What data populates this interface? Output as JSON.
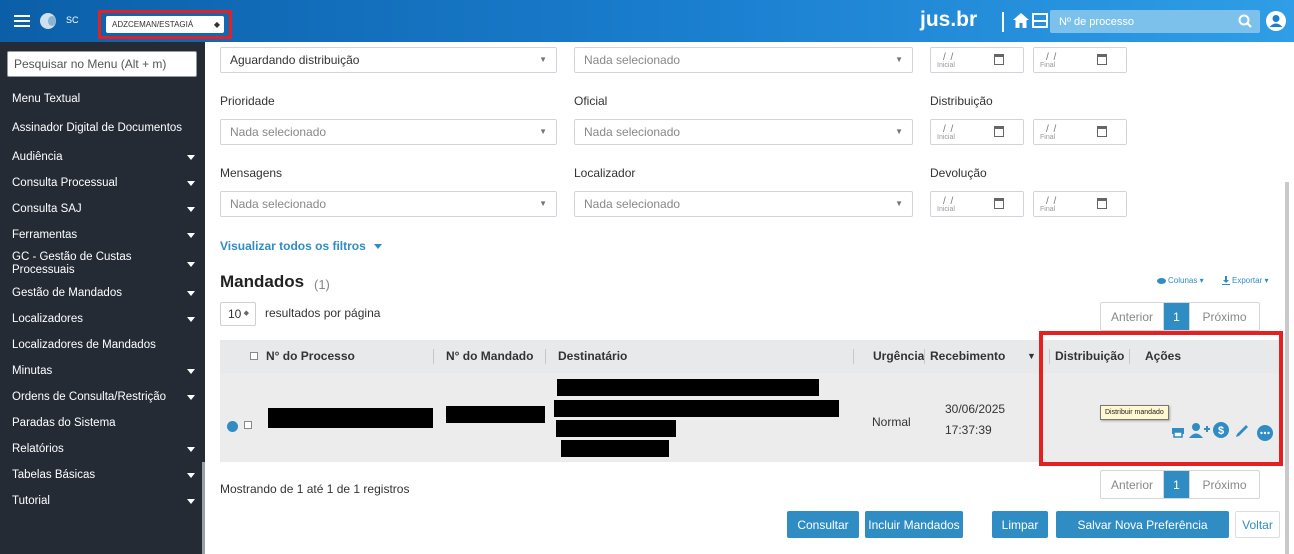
{
  "topbar": {
    "uf": "SC",
    "profile": "ADZCEMAN/ESTAGIÁ",
    "brand": "jus.br",
    "process_placeholder": "Nº de processo"
  },
  "sidebar": {
    "search_placeholder": "Pesquisar no Menu (Alt + m)",
    "items": [
      {
        "label": "Menu Textual",
        "submenu": false
      },
      {
        "label": "Assinador Digital de Documentos",
        "submenu": false
      },
      {
        "label": "Audiência",
        "submenu": true
      },
      {
        "label": "Consulta Processual",
        "submenu": true
      },
      {
        "label": "Consulta SAJ",
        "submenu": true
      },
      {
        "label": "Ferramentas",
        "submenu": true
      },
      {
        "label": "GC - Gestão de Custas Processuais",
        "submenu": true
      },
      {
        "label": "Gestão de Mandados",
        "submenu": true
      },
      {
        "label": "Localizadores",
        "submenu": true
      },
      {
        "label": "Localizadores de Mandados",
        "submenu": false
      },
      {
        "label": "Minutas",
        "submenu": true
      },
      {
        "label": "Ordens de Consulta/Restrição",
        "submenu": true
      },
      {
        "label": "Paradas do Sistema",
        "submenu": false
      },
      {
        "label": "Relatórios",
        "submenu": true
      },
      {
        "label": "Tabelas Básicas",
        "submenu": true
      },
      {
        "label": "Tutorial",
        "submenu": true
      }
    ]
  },
  "filters": {
    "status_value": "Aguardando distribuição",
    "nothing_selected": "Nada selecionado",
    "date_mask": "/ /",
    "date_initial": "Inicial",
    "date_final": "Final",
    "prioridade": "Prioridade",
    "oficial": "Oficial",
    "distribuicao": "Distribuição",
    "mensagens": "Mensagens",
    "localizador": "Localizador",
    "devolucao": "Devolução",
    "show_all": "Visualizar todos os filtros"
  },
  "list": {
    "title": "Mandados",
    "count": "(1)",
    "columns_btn": "Colunas",
    "export_btn": "Exportar",
    "per_page": "10",
    "per_page_label": "resultados por página",
    "pager": {
      "prev": "Anterior",
      "current": "1",
      "next": "Próximo"
    },
    "headers": {
      "processo": "N° do Processo",
      "mandado": "N° do Mandado",
      "destinatario": "Destinatário",
      "urgencia": "Urgência",
      "recebimento": "Recebimento",
      "distribuicao": "Distribuição",
      "acoes": "Ações"
    },
    "row": {
      "urgencia": "Normal",
      "recebimento_date": "30/06/2025",
      "recebimento_time": "17:37:39",
      "tooltip": "Distribuir mandado"
    },
    "summary": "Mostrando de 1 até 1 de 1 registros"
  },
  "actions": {
    "consultar": "Consultar",
    "incluir": "Incluir Mandados",
    "limpar": "Limpar",
    "salvar": "Salvar Nova Preferência",
    "voltar": "Voltar"
  },
  "colors": {
    "primary": "#2f8dc4",
    "highlight": "#e52020",
    "sidebar": "#252b35"
  }
}
